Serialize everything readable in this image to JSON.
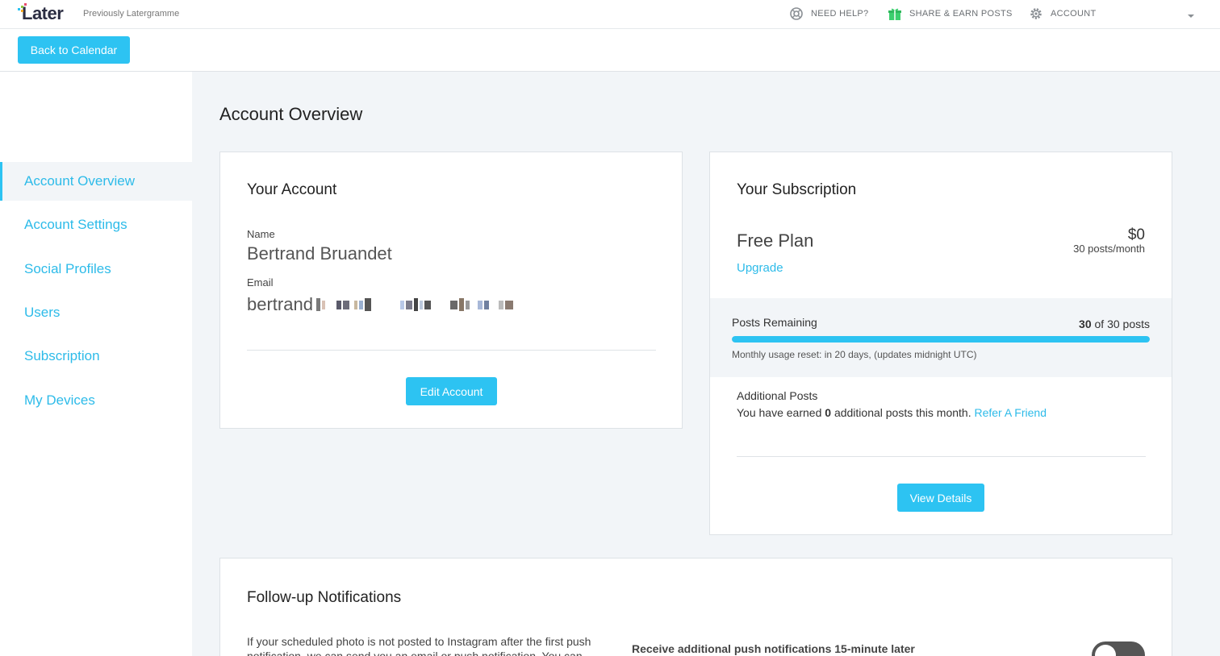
{
  "brand": {
    "logo_text": "Later",
    "tagline": "Previously Latergramme",
    "colors": {
      "accent": "#2dc3f2",
      "link": "#2dbbe9",
      "logo_text": "#2b2d42"
    }
  },
  "topnav": {
    "help": {
      "label": "NEED HELP?",
      "icon": "lifebuoy-icon"
    },
    "share": {
      "label": "SHARE & EARN POSTS",
      "icon": "gift-icon"
    },
    "account": {
      "label": "ACCOUNT",
      "icon": "gear-icon"
    },
    "caret_icon": "chevron-down-icon"
  },
  "subbar": {
    "back_label": "Back to Calendar"
  },
  "sidebar": {
    "items": [
      {
        "label": "Account Overview",
        "active": true
      },
      {
        "label": "Account Settings",
        "active": false
      },
      {
        "label": "Social Profiles",
        "active": false
      },
      {
        "label": "Users",
        "active": false
      },
      {
        "label": "Subscription",
        "active": false
      },
      {
        "label": "My Devices",
        "active": false
      }
    ]
  },
  "main": {
    "title": "Account Overview",
    "account_card": {
      "title": "Your Account",
      "name_label": "Name",
      "name_value": "Bertrand Bruandet",
      "email_label": "Email",
      "email_visible": "bertrand",
      "edit_label": "Edit Account"
    },
    "subscription_card": {
      "title": "Your Subscription",
      "plan_name": "Free Plan",
      "price": "$0",
      "per": "30 posts/month",
      "upgrade_label": "Upgrade",
      "posts_remaining_label": "Posts Remaining",
      "remaining_count": "30",
      "remaining_suffix": "of 30 posts",
      "remaining_fraction": 1.0,
      "reset_text": "Monthly usage reset: in 20 days, (updates midnight UTC)",
      "additional_title": "Additional Posts",
      "earned_prefix": "You have earned",
      "earned_count": "0",
      "earned_suffix": "additional posts this month.",
      "refer_label": "Refer A Friend",
      "details_label": "View Details"
    },
    "followup_card": {
      "title": "Follow-up Notifications",
      "text": "If your scheduled photo is not posted to Instagram after the first push notification, we can send you an email or push notification. You can",
      "option_label": "Receive additional push notifications 15-minute later"
    }
  }
}
